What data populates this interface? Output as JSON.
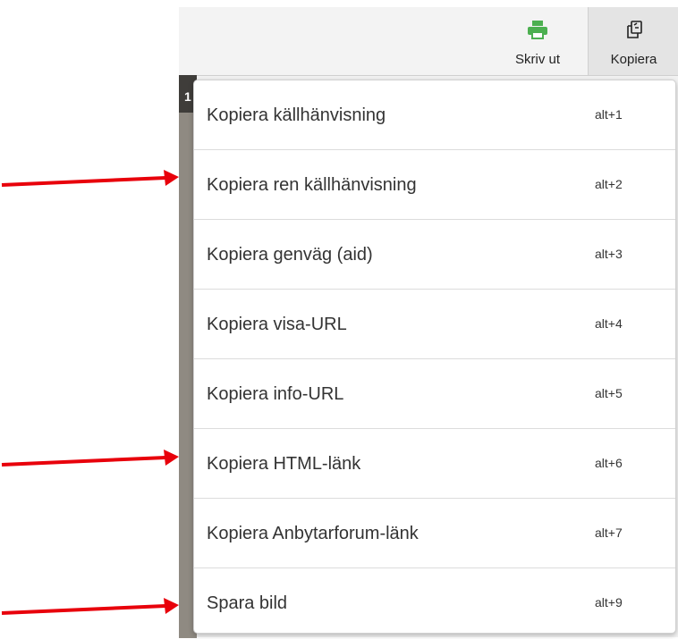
{
  "toolbar": {
    "print": {
      "label": "Skriv ut",
      "icon": "printer-icon",
      "icon_color": "#4caf50"
    },
    "copy": {
      "label": "Kopiera",
      "icon": "copy-icon"
    }
  },
  "viewer": {
    "chip_text": "1"
  },
  "menu": {
    "items": [
      {
        "label": "Kopiera källhänvisning",
        "shortcut": "alt+1"
      },
      {
        "label": "Kopiera ren källhänvisning",
        "shortcut": "alt+2"
      },
      {
        "label": "Kopiera genväg (aid)",
        "shortcut": "alt+3"
      },
      {
        "label": "Kopiera visa-URL",
        "shortcut": "alt+4"
      },
      {
        "label": "Kopiera info-URL",
        "shortcut": "alt+5"
      },
      {
        "label": "Kopiera HTML-länk",
        "shortcut": "alt+6"
      },
      {
        "label": "Kopiera Anbytarforum-länk",
        "shortcut": "alt+7"
      },
      {
        "label": "Spara bild",
        "shortcut": "alt+9"
      }
    ]
  },
  "annotations": {
    "arrow_color": "#e8000b"
  }
}
